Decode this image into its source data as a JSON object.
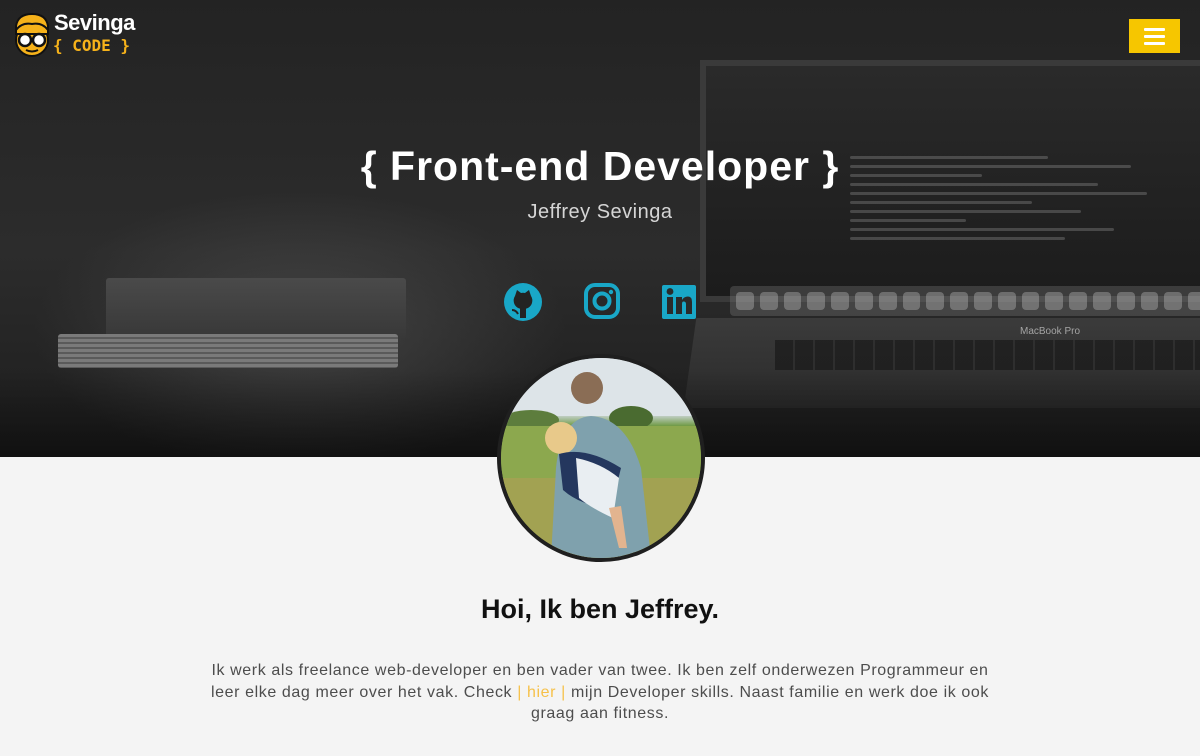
{
  "brand": {
    "name": "Sevinga",
    "code_label": "{ CODE }",
    "accent_color": "#f6c600"
  },
  "header": {
    "menu_icon": "hamburger-icon"
  },
  "hero": {
    "title": "{ Front-end Developer }",
    "subtitle": "Jeffrey Sevinga",
    "social_icons": [
      "github-icon",
      "instagram-icon",
      "linkedin-icon"
    ],
    "social_color": "#19a7c7",
    "laptop_label": "MacBook Pro"
  },
  "about": {
    "greeting": "Hoi, Ik ben Jeffrey.",
    "text_before_link": "Ik werk als freelance web-developer en ben vader van twee. Ik ben zelf onderwezen Programmeur en leer elke dag meer over het vak. Check ",
    "link_text": "| hier |",
    "text_after_link": " mijn Developer skills. Naast familie en werk doe ik ook graag aan fitness."
  }
}
